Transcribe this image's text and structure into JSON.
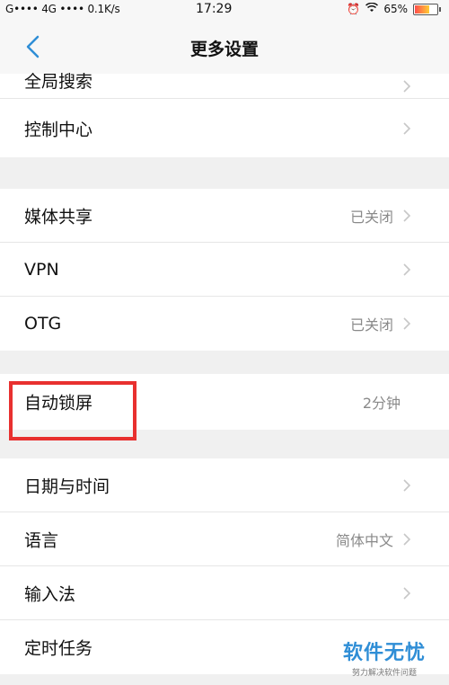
{
  "statusbar": {
    "left": "G•••• 4G •••• 0.1K/s",
    "time": "17:29",
    "battery": "65%",
    "battery_level": 0.65
  },
  "nav": {
    "title": "更多设置"
  },
  "group1": [
    {
      "label": "全局搜索"
    },
    {
      "label": "控制中心"
    }
  ],
  "group2": [
    {
      "label": "媒体共享",
      "value": "已关闭"
    },
    {
      "label": "VPN"
    },
    {
      "label": "OTG",
      "value": "已关闭"
    }
  ],
  "group3": [
    {
      "label": "自动锁屏",
      "value": "2分钟"
    }
  ],
  "group4": [
    {
      "label": "日期与时间"
    },
    {
      "label": "语言",
      "value": "简体中文"
    },
    {
      "label": "输入法"
    },
    {
      "label": "定时任务"
    }
  ],
  "watermark": {
    "main": "软件无忧",
    "sub": "努力解决软件问题"
  },
  "colors": {
    "highlight": "#e8302f",
    "accent": "#2f8ed6"
  }
}
